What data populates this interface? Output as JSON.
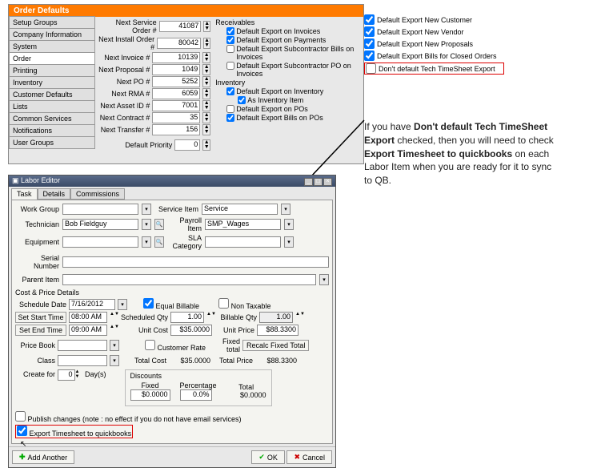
{
  "orderDefaults": {
    "title": "Order Defaults",
    "sidebar": [
      "Setup Groups",
      "Company Information",
      "System",
      "Order",
      "Printing",
      "Inventory",
      "Customer Defaults",
      "Lists",
      "Common Services",
      "Notifications",
      "User Groups"
    ],
    "numbers": {
      "nextServiceOrder": {
        "label": "Next Service Order #",
        "value": "41087"
      },
      "nextInstallOrder": {
        "label": "Next Install Order #",
        "value": "80042"
      },
      "nextInvoice": {
        "label": "Next Invoice #",
        "value": "10139"
      },
      "nextProposal": {
        "label": "Next Proposal #",
        "value": "1049"
      },
      "nextPO": {
        "label": "Next PO #",
        "value": "5252"
      },
      "nextRMA": {
        "label": "Next RMA #",
        "value": "6059"
      },
      "nextAssetID": {
        "label": "Next Asset ID #",
        "value": "7001"
      },
      "nextContract": {
        "label": "Next Contract #",
        "value": "35"
      },
      "nextTransfer": {
        "label": "Next Transfer #",
        "value": "156"
      },
      "defaultPriority": {
        "label": "Default Priority",
        "value": "0"
      }
    },
    "receivables": {
      "label": "Receivables",
      "r1": "Default Export on Invoices",
      "r2": "Default Export on Payments",
      "r3": "Default Export Subcontractor Bills on Invoices",
      "r4": "Default Export Subcontractor PO on Invoices"
    },
    "inventory": {
      "label": "Inventory",
      "i1": "Default Export on Inventory",
      "i2": "As Inventory Item",
      "i3": "Default Export on POs",
      "i4": "Default Export Bills on POs"
    },
    "right": {
      "c1": "Default Export New Customer",
      "c2": "Default Export New Vendor",
      "c3": "Default Export New Proposals",
      "c4": "Default Export Bills for Closed Orders",
      "c5": "Don't default Tech TimeSheet Export"
    }
  },
  "labor": {
    "windowTitle": "Labor Editor",
    "tabs": [
      "Task",
      "Details",
      "Commissions"
    ],
    "workGroupLabel": "Work Group",
    "technicianLabel": "Technician",
    "technicianValue": "Bob Fieldguy",
    "equipmentLabel": "Equipment",
    "serviceItemLabel": "Service Item",
    "serviceItemValue": "Service",
    "payrollItemLabel": "Payroll Item",
    "payrollItemValue": "SMP_Wages",
    "slaLabel": "SLA Category",
    "serialLabel": "Serial Number",
    "parentLabel": "Parent Item",
    "costPriceLabel": "Cost & Price Details",
    "scheduleDateLabel": "Schedule Date",
    "scheduleDateValue": "7/16/2012",
    "setStartLabel": "Set Start Time",
    "setStartValue": "08:00 AM",
    "setEndLabel": "Set End Time",
    "setEndValue": "09:00 AM",
    "priceBookLabel": "Price Book",
    "classLabel": "Class",
    "createForLabel": "Create for",
    "createForValue": "0",
    "daysLabel": "Day(s)",
    "equalBillable": "Equal Billable",
    "scheduledQtyLabel": "Scheduled Qty",
    "scheduledQtyValue": "1.00",
    "unitCostLabel": "Unit Cost",
    "unitCostValue": "$35.0000",
    "customerRate": "Customer Rate",
    "totalCostLabel": "Total Cost",
    "totalCostValue": "$35.0000",
    "nonTaxable": "Non Taxable",
    "billableQtyLabel": "Billable Qty",
    "billableQtyValue": "1.00",
    "unitPriceLabel": "Unit Price",
    "unitPriceValue": "$88.3300",
    "fixedTotalLabel": "Fixed total",
    "recalcLabel": "Recalc Fixed Total",
    "totalPriceLabel": "Total Price",
    "totalPriceValue": "$88.3300",
    "discountsLabel": "Discounts",
    "fixedLabel": "Fixed",
    "fixedValue": "$0.0000",
    "percentageLabel": "Percentage",
    "percentageValue": "0.0%",
    "totalLabel": "Total",
    "totalValue": "$0.0000",
    "publishChanges": "Publish changes (note : no effect if you do not have email services)",
    "exportTimesheet": "Export Timesheet to quickbooks",
    "addAnother": "Add Another",
    "ok": "OK",
    "cancel": "Cancel"
  },
  "callout": {
    "p1a": "If you have ",
    "p1b": "Don't default Tech TimeSheet Export",
    "p1c": " checked, then you will need to check ",
    "p1d": "Export Timesheet to quickbooks",
    "p1e": " on each Labor Item when you are ready for it to sync to QB."
  }
}
